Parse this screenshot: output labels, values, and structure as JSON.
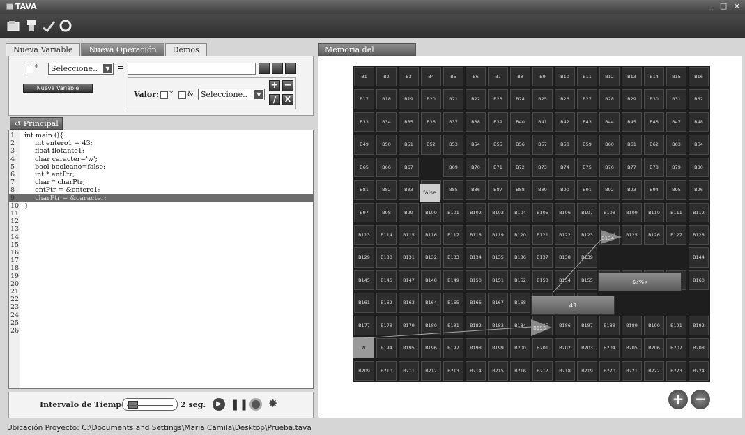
{
  "window": {
    "title": "TAVA",
    "controls": "_ □ ×"
  },
  "toolbar": {
    "icons": [
      "open-icon",
      "save-icon",
      "compile-icon",
      "help-icon"
    ]
  },
  "tabs": [
    {
      "label": "Nueva Variable",
      "active": false
    },
    {
      "label": "Nueva Operación",
      "active": true
    },
    {
      "label": "Demos",
      "active": false
    }
  ],
  "op": {
    "star": "*",
    "select1": "Seleccione..",
    "equals": "=",
    "new_var_button": "Nueva Variable",
    "valor_label": "Valor:",
    "amp": "&",
    "select2": "Seleccione..",
    "plus": "+",
    "minus": "−",
    "div": "/",
    "times": "X"
  },
  "editor": {
    "tab_label": "Principal",
    "highlight_line": 9,
    "lines": [
      "int main (){",
      "     int entero1 = 43;",
      "     float flotante1;",
      "     char caracter='w';",
      "     bool booleano=false;",
      "     int * entPtr;",
      "     char * charPtr;",
      "     entPtr = &entero1;",
      "     charPtr = &caracter;",
      "}",
      "",
      "",
      "",
      "",
      "",
      "",
      "",
      "",
      "",
      "",
      "",
      "",
      "",
      "",
      "",
      ""
    ]
  },
  "timer": {
    "label": "Intervalo de Tiempo:",
    "value": "2 seg."
  },
  "status": {
    "text": "Ubicación Proyecto: C:\\Documents and Settings\\Maria Camila\\Desktop\\Prueba.tava"
  },
  "memory": {
    "tab_label": "Memoria del Computador",
    "cols": 16,
    "rows": 14,
    "cell_prefix": "B",
    "blocks": {
      "false": "false",
      "int43": "43",
      "ptr1": "$?%«",
      "char_w": "w",
      "arrow1_label": "B134",
      "arrow2_label": "B193"
    },
    "zoom_in": "+",
    "zoom_out": "−"
  }
}
